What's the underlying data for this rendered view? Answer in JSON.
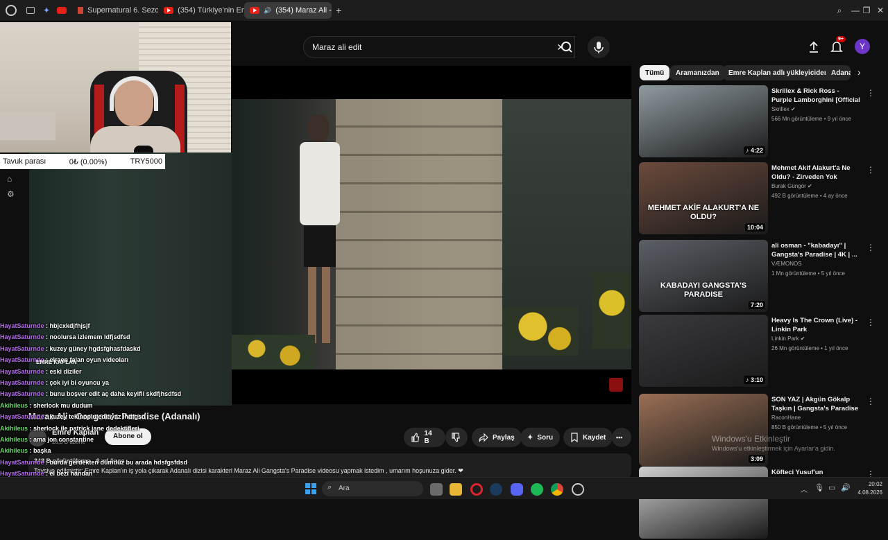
{
  "browser": {
    "tabs": [
      {
        "label": "Supernatural 6. Sezon 5. Bö"
      },
      {
        "label": "(354) Türkiye'nin En Gizem"
      },
      {
        "label": "(354) Maraz Ali - Gangs"
      }
    ],
    "new_tab": "+"
  },
  "overlay": {
    "ticker": {
      "label": "Tavuk parası",
      "value": "0₺ (0.00%)",
      "goal": "TRY5000"
    },
    "logo_text": "EMRE KAPLAN"
  },
  "search": {
    "value": "Maraz ali edit"
  },
  "header": {
    "notif_count": "9+",
    "avatar_letter": "Y"
  },
  "chat": [
    {
      "user": "HayatSaturnde",
      "msg": "hbjcxkdjfhjsjf",
      "color": "purple"
    },
    {
      "user": "HayatSaturnde",
      "msg": "noolursa izlemem ldfjsdfsd",
      "color": "purple"
    },
    {
      "user": "HayatSaturnde",
      "msg": "kuzey güney hgdsfghasfdaskd",
      "color": "purple"
    },
    {
      "user": "HayatSaturnde",
      "msg": "elraen falan oyun videoları",
      "color": "purple"
    },
    {
      "user": "HayatSaturnde",
      "msg": "eski diziler",
      "color": "purple"
    },
    {
      "user": "HayatSaturnde",
      "msg": "çok iyi bi oyuncu ya",
      "color": "purple"
    },
    {
      "user": "HayatSaturnde",
      "msg": "bunu boşver edit aç daha keyifli skdfjhsdfsd",
      "color": "purple"
    },
    {
      "user": "Akihileus",
      "msg": "sherlock mu dudum",
      "color": "green"
    },
    {
      "user": "HayatSaturnde",
      "msg": "kuzey tekinoplu edit yaz ihdfgsd",
      "color": "purple"
    },
    {
      "user": "Akihileus",
      "msg": "sherlock ile patrick jane dedektifleri",
      "color": "green"
    },
    {
      "user": "Akihileus",
      "msg": "ama jon constantine",
      "color": "green"
    },
    {
      "user": "Akihileus",
      "msg": "başka",
      "color": "green"
    },
    {
      "user": "HayatSaturnde",
      "msg": "burda gerdekten dümdüz bu arada hdsfgsfdsd",
      "color": "purple"
    },
    {
      "user": "HayatSaturnde",
      "msg": "el bezi handan",
      "color": "purple"
    },
    {
      "user": "HayatSaturnde",
      "msg": "sdmfhbsdjfbsdkf",
      "color": "purple"
    }
  ],
  "video": {
    "title": "Maraz Ali - Gangsta's Paradise (Adanalı)",
    "channel": "Emre Kaplan",
    "subscribers": "28,3 B abone",
    "subscribe_label": "Abone ol",
    "like_count": "14 B",
    "share_label": "Paylaş",
    "ask_label": "Soru",
    "save_label": "Kaydet",
    "more_label": "•••",
    "views": "348 B görüntüleme",
    "age": "6 yıl önce",
    "description": "Tavsiye edilmiştir: Emre Kaplan'ın iş yola çıkarak Adanalı dizisi karakteri Maraz Ali Gangsta's Paradise videosu yapmak istedim , umarım hoşunuza gider. ❤"
  },
  "chips": [
    {
      "label": "Tümü",
      "active": true
    },
    {
      "label": "Aramanızdan"
    },
    {
      "label": "Emre Kaplan adlı yükleyiciden"
    },
    {
      "label": "Adana"
    }
  ],
  "recommendations": [
    {
      "title": "Skrillex & Rick Ross - Purple Lamborghini [Official Video]",
      "channel": "Skrillex",
      "meta": "566 Mn görüntüleme • 9 yıl önce",
      "duration": "♪ 4:22",
      "thumb_color": "#8f9aa0",
      "verified": true
    },
    {
      "title": "Mehmet Akif Alakurt'a Ne Oldu? - Zirveden Yok Oluşa...",
      "channel": "Burak Güngör",
      "meta": "492 B görüntüleme • 4 ay önce",
      "duration": "10:04",
      "thumb_color": "#6b4a3c",
      "thumb_text": "MEHMET AKİF ALAKURT'A NE OLDU?",
      "verified": true
    },
    {
      "title": "ali osman - \"kabadayı\" | Gangsta's Paradise | 4K | ...",
      "channel": "VÆMONOS",
      "meta": "1 Mn görüntüleme • 5 yıl önce",
      "duration": "7:20",
      "thumb_color": "#5b5f66",
      "thumb_text": "KABADAYI GANGSTA'S PARADISE"
    },
    {
      "title": "Heavy Is The Crown (Live) - Linkin Park",
      "channel": "Linkin Park",
      "meta": "26 Mn görüntüleme • 1 yıl önce",
      "duration": "♪ 3:10",
      "thumb_color": "#3a3a3f",
      "verified": true
    },
    {
      "title": "SON YAZ | Akgün Gökalp Taşkın | Gangsta's Paradise",
      "channel": "RaconHane",
      "meta": "850 B görüntüleme • 5 yıl önce",
      "duration": "3:09",
      "thumb_color": "#9a6f55"
    },
    {
      "title": "Köfteci Yusuf'un yanındayız!",
      "channel": "",
      "meta": "",
      "duration": "",
      "thumb_color": "#cfcfcf"
    }
  ],
  "windows": {
    "activate_title": "Windows'u Etkinleştir",
    "activate_sub": "Windows'u etkinleştirmek için Ayarlar'a gidin."
  },
  "taskbar": {
    "search_placeholder": "Ara",
    "time": "20:02",
    "date": "4.08.2026"
  }
}
